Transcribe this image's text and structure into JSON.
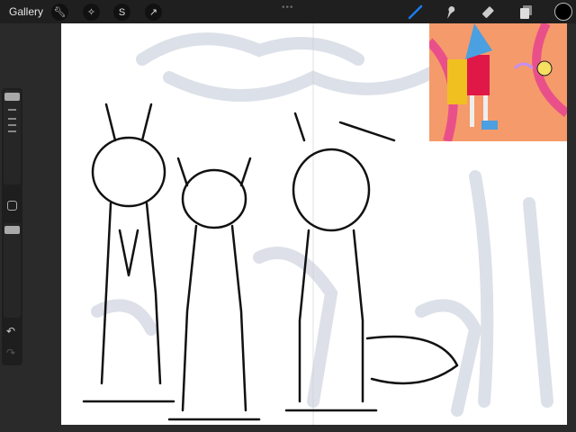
{
  "topbar": {
    "gallery_label": "Gallery",
    "left_tools": [
      "wrench-icon",
      "magic-wand-icon",
      "selection-icon",
      "transform-arrow-icon"
    ],
    "right_tools": [
      "brush-icon",
      "smudge-icon",
      "eraser-icon",
      "layers-icon"
    ],
    "active_tool": "brush",
    "current_color": "#000000",
    "accent": "#1a7cf0"
  },
  "sidebar": {
    "controls": [
      "brush-size-slider",
      "modify-button",
      "opacity-slider",
      "undo-button",
      "redo-button"
    ]
  },
  "reference": {
    "panel": "reference-image"
  }
}
